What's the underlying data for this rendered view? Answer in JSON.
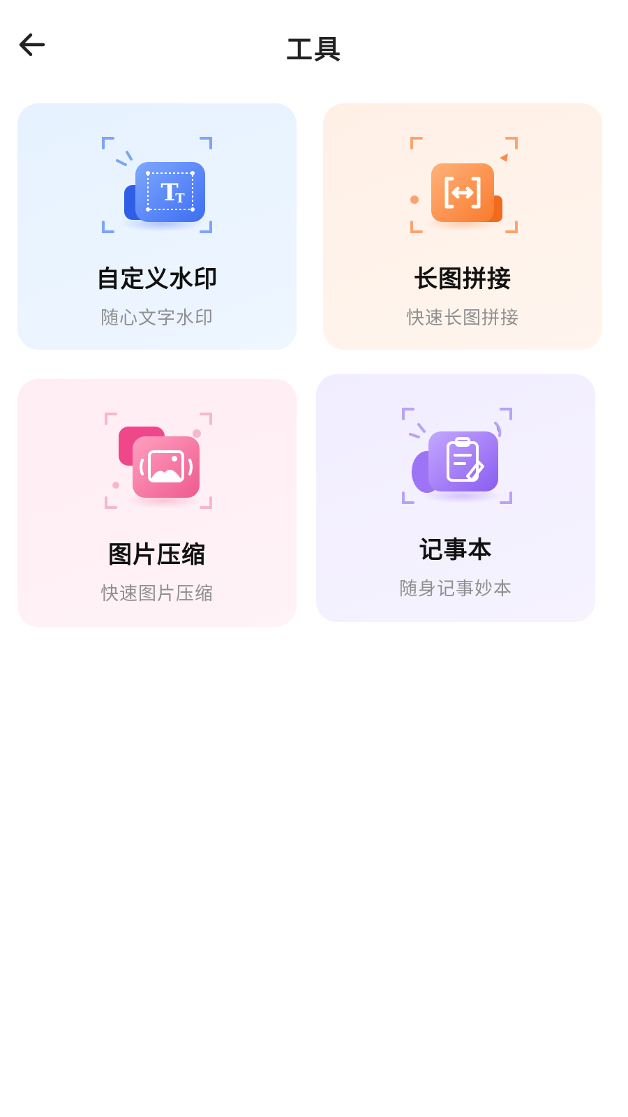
{
  "header": {
    "title": "工具",
    "back_icon": "arrow-left-icon"
  },
  "tools": [
    {
      "name": "自定义水印",
      "desc": "随心文字水印",
      "icon": "text-watermark-icon",
      "color": "#3d6df2"
    },
    {
      "name": "长图拼接",
      "desc": "快速长图拼接",
      "icon": "long-image-stitch-icon",
      "color": "#f97a2d"
    },
    {
      "name": "图片压缩",
      "desc": "快速图片压缩",
      "icon": "image-compress-icon",
      "color": "#ee5a8e"
    },
    {
      "name": "记事本",
      "desc": "随身记事妙本",
      "icon": "notepad-icon",
      "color": "#8a5cf0"
    }
  ]
}
